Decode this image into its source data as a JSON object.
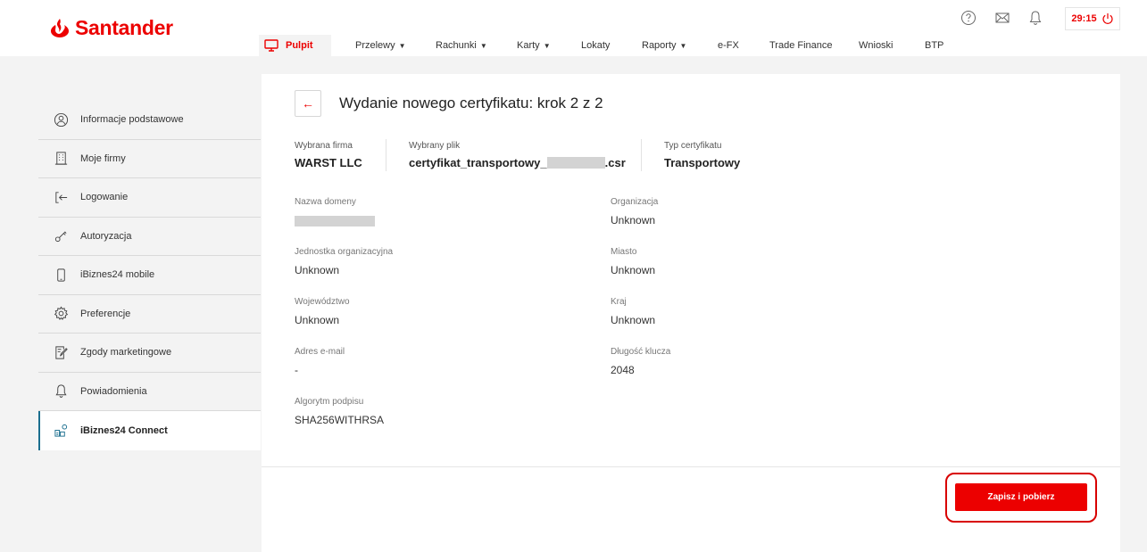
{
  "brand": {
    "name": "Santander",
    "color": "#ec0000"
  },
  "topnav": [
    {
      "label": "Pulpit",
      "active": true,
      "caret": false
    },
    {
      "label": "Przelewy",
      "caret": true
    },
    {
      "label": "Rachunki",
      "caret": true
    },
    {
      "label": "Karty",
      "caret": true
    },
    {
      "label": "Lokaty",
      "caret": false
    },
    {
      "label": "Raporty",
      "caret": true
    },
    {
      "label": "e-FX",
      "caret": false
    },
    {
      "label": "Trade Finance",
      "caret": false
    },
    {
      "label": "Wnioski",
      "caret": false
    },
    {
      "label": "BTP",
      "caret": false
    }
  ],
  "header": {
    "timer": "29:15",
    "icons": [
      "help-icon",
      "mail-icon",
      "bell-icon",
      "power-icon"
    ]
  },
  "sidebar": {
    "items": [
      {
        "label": "Informacje podstawowe",
        "icon": "user-circle-icon"
      },
      {
        "label": "Moje firmy",
        "icon": "building-icon"
      },
      {
        "label": "Logowanie",
        "icon": "login-icon"
      },
      {
        "label": "Autoryzacja",
        "icon": "key-icon"
      },
      {
        "label": "iBiznes24 mobile",
        "icon": "phone-icon"
      },
      {
        "label": "Preferencje",
        "icon": "gear-icon"
      },
      {
        "label": "Zgody marketingowe",
        "icon": "document-edit-icon"
      },
      {
        "label": "Powiadomienia",
        "icon": "bell-icon"
      },
      {
        "label": "iBiznes24 Connect",
        "icon": "connect-icon",
        "active": true
      }
    ]
  },
  "main": {
    "title": "Wydanie nowego certyfikatu: krok 2 z 2",
    "summary": {
      "company_label": "Wybrana firma",
      "company_value": "WARST LLC",
      "file_label": "Wybrany plik",
      "file_prefix": "certyfikat_transportowy_",
      "file_suffix": ".csr",
      "type_label": "Typ certyfikatu",
      "type_value": "Transportowy"
    },
    "fields": {
      "domain_label": "Nazwa domeny",
      "org_label": "Organizacja",
      "org_value": "Unknown",
      "unit_label": "Jednostka organizacyjna",
      "unit_value": "Unknown",
      "city_label": "Miasto",
      "city_value": "Unknown",
      "province_label": "Województwo",
      "province_value": "Unknown",
      "country_label": "Kraj",
      "country_value": "Unknown",
      "email_label": "Adres e-mail",
      "email_value": "-",
      "keylen_label": "Długość klucza",
      "keylen_value": "2048",
      "algo_label": "Algorytm podpisu",
      "algo_value": "SHA256WITHRSA"
    },
    "save_button": "Zapisz i pobierz"
  }
}
